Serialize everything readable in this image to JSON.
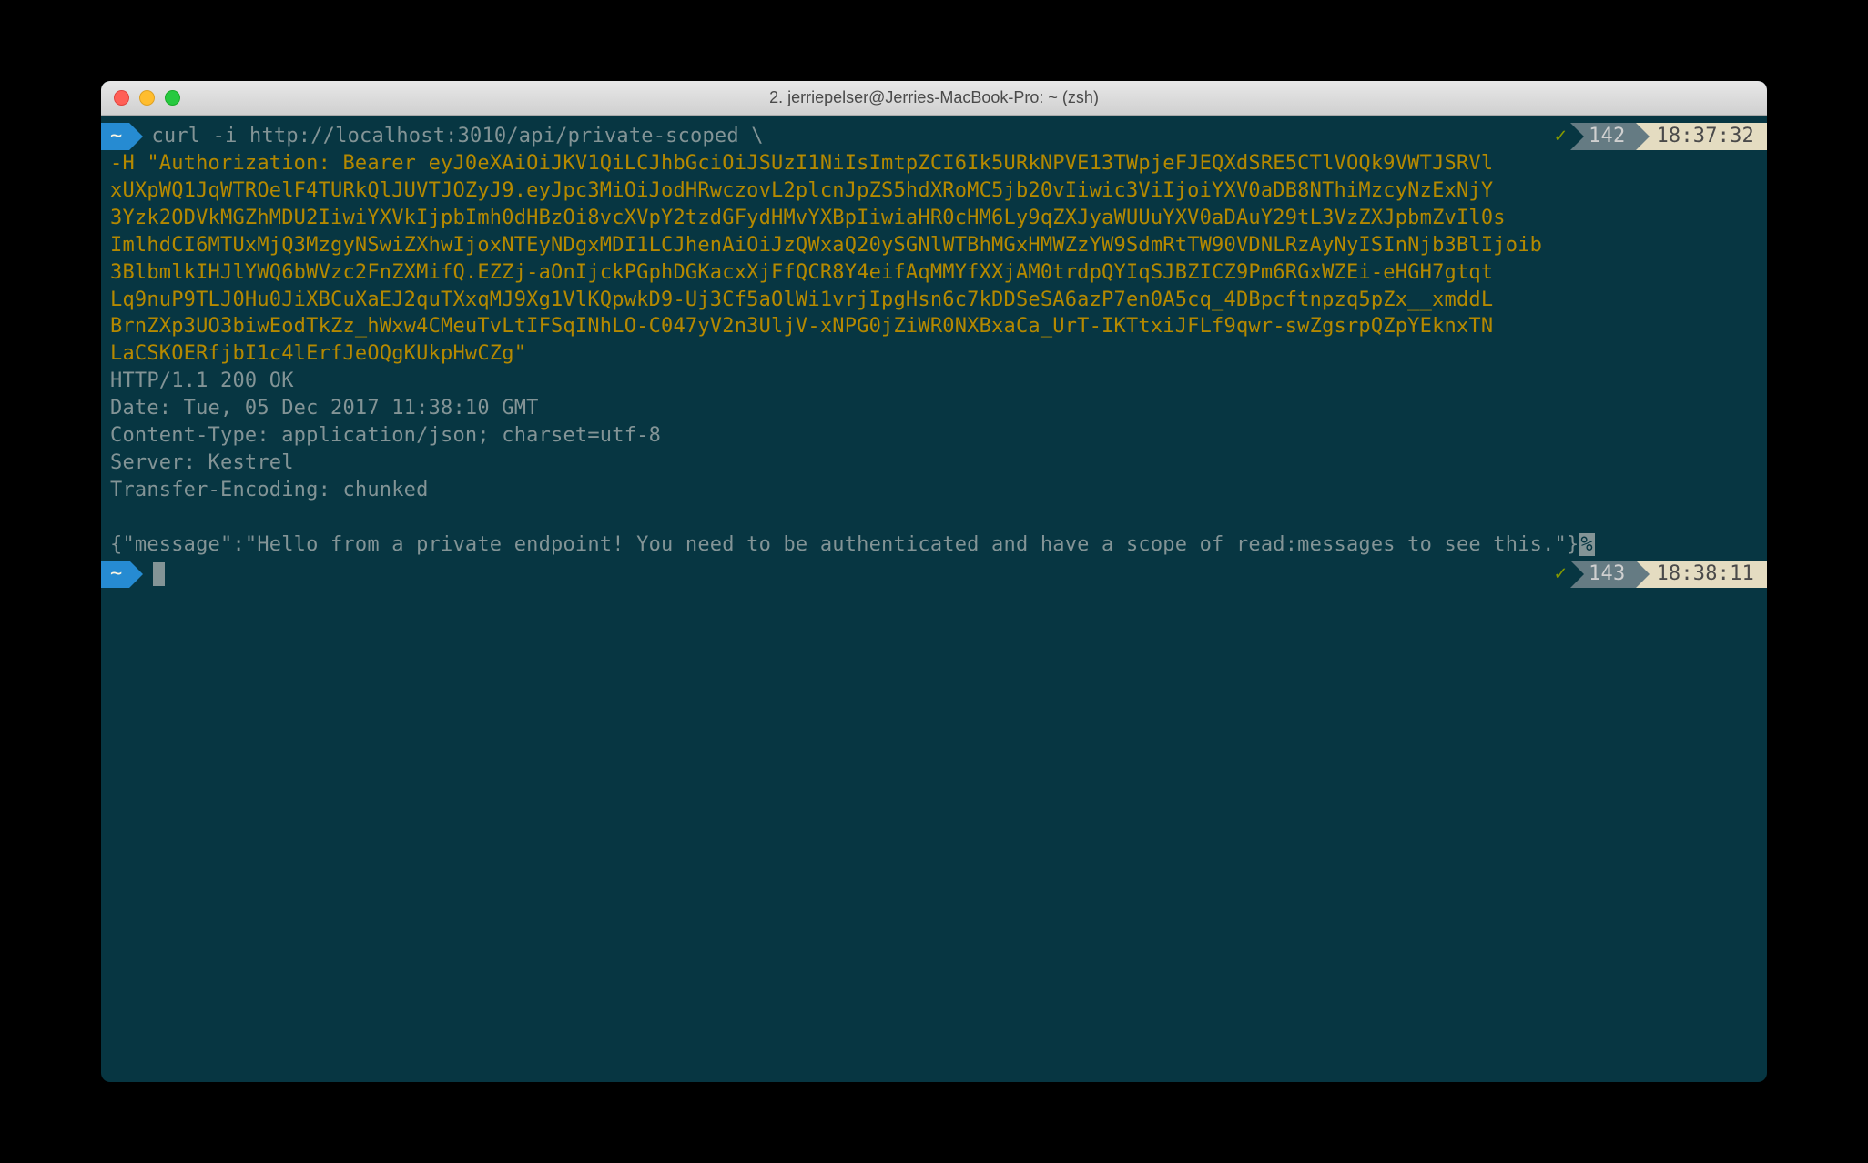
{
  "window": {
    "title": "2. jerriepelser@Jerries-MacBook-Pro: ~ (zsh)"
  },
  "prompt1": {
    "path": "~",
    "command_prefix": "curl -i http://localhost:3010/api/private-scoped \\",
    "check": "✓",
    "num": "142",
    "time": "18:37:32"
  },
  "token_block": "-H \"Authorization: Bearer eyJ0eXAiOiJKV1QiLCJhbGciOiJSUzI1NiIsImtpZCI6Ik5URkNPVE13TWpjeFJEQXdSR­E5CTlVOQk9VWTJSRVl\nxUXpWQ1JqWTROelF4TURkQlJUVTJOZyJ9.eyJpc3MiOiJodHRwczovL2plcnJpZS5hdXRoMC5jb20vIiwic3ViIjoiYXV0aDB8NThiMzcyNzExNjY\n3Yzk2ODVkMGZhMDU2IiwiYXVkIjpbImh0dHBzOi8vcXVpY2tzdGFydHMvYXBpIiwiaHR0cHM6Ly9qZXJyaWUUuYXV0aDAuY29tL3VzZXJpbmZvIl0s\nImlhdCI6MTUxMjQ3MzgyNSwiZXhwIjoxNTEyNDgxMDI1LCJhenAiOiJzQWxaQ20ySGNlWTBhMGxHMWZzYW9SdmRtTW90VDNLRzAyNyISInNjb3BlIjoib\n3BlbmlkIHJlYWQ6bWVzc2FnZXMifQ.EZZj-aOnIjckPGphDGKacxXjFfQCR8Y4eifAqMMYfXXjAM0trdpQYIqSJBZICZ9Pm6RGxWZEi-eHGH7gtqt\nLq9nuP9TLJ0Hu0JiXBCuXaEJ2quTXxqMJ9Xg1VlKQpwkD9-Uj3Cf5aOlWi1vrjIpgHsn6c7kDDSeSA6azP7en0A5cq_4DBpcftnpzq5pZx__xmddL\nBrnZXp3UO3biwEodTkZz_hWxw4CMeuTvLtIFSqINhLO-C047yV2n3UljV-xNPG0jZiWR0NXBxaCa_UrT-IKTtxiJFLf9qwr-swZgsrpQZpYEknxTN\nLaCSKOERfjbI1c4lErfJeOQgKUkpHwCZg\"",
  "response": {
    "status_line": "HTTP/1.1 200 OK",
    "date": "Date: Tue, 05 Dec 2017 11:38:10 GMT",
    "content_type": "Content-Type: application/json; charset=utf-8",
    "server": "Server: Kestrel",
    "transfer": "Transfer-Encoding: chunked",
    "body_prefix": "{\"message\":\"Hello from a private endpoint! You need to be authenticated and have a scope of read:messages to see this.\"}",
    "pct": "%"
  },
  "prompt2": {
    "path": "~",
    "check": "✓",
    "num": "143",
    "time": "18:38:11"
  }
}
